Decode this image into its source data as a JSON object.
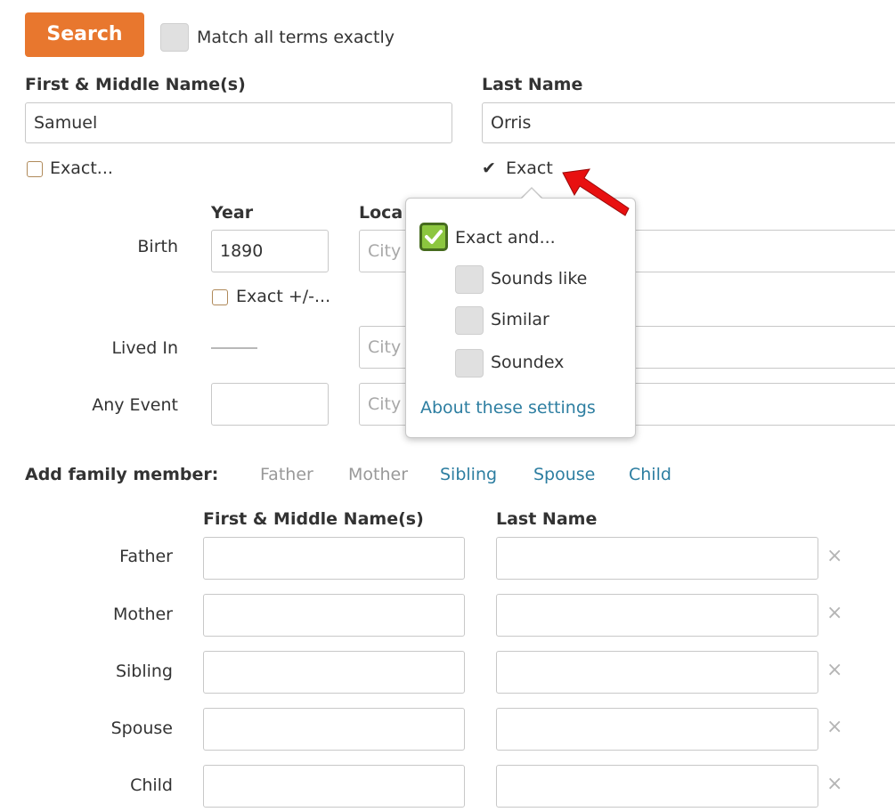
{
  "toolbar": {
    "search_label": "Search",
    "match_all_label": "Match all terms exactly"
  },
  "name": {
    "first_label": "First & Middle Name(s)",
    "first_value": "Samuel",
    "last_label": "Last Name",
    "last_value": "Orris",
    "first_exact_label": "Exact...",
    "last_exact_label": "Exact"
  },
  "events": {
    "year_header": "Year",
    "location_header": "Loca",
    "city_placeholder": "City",
    "birth": {
      "label": "Birth",
      "year": "1890",
      "exact_label": "Exact +/-..."
    },
    "lived_in": {
      "label": "Lived In"
    },
    "any_event": {
      "label": "Any Event"
    }
  },
  "popover": {
    "exact_and_label": "Exact and...",
    "options": [
      "Sounds like",
      "Similar",
      "Soundex"
    ],
    "about_link": "About these settings",
    "exact_and_checked": true
  },
  "family": {
    "add_label": "Add family member:",
    "links": [
      {
        "label": "Father",
        "enabled": false
      },
      {
        "label": "Mother",
        "enabled": false
      },
      {
        "label": "Sibling",
        "enabled": true
      },
      {
        "label": "Spouse",
        "enabled": true
      },
      {
        "label": "Child",
        "enabled": true
      }
    ],
    "first_header": "First & Middle Name(s)",
    "last_header": "Last Name",
    "rows": [
      "Father",
      "Mother",
      "Sibling",
      "Spouse",
      "Child"
    ],
    "remove_icon": "×"
  },
  "colors": {
    "accent": "#e8772e",
    "link": "#2d7ea1",
    "check_green": "#8cc63f",
    "arrow_red": "#e81010"
  }
}
